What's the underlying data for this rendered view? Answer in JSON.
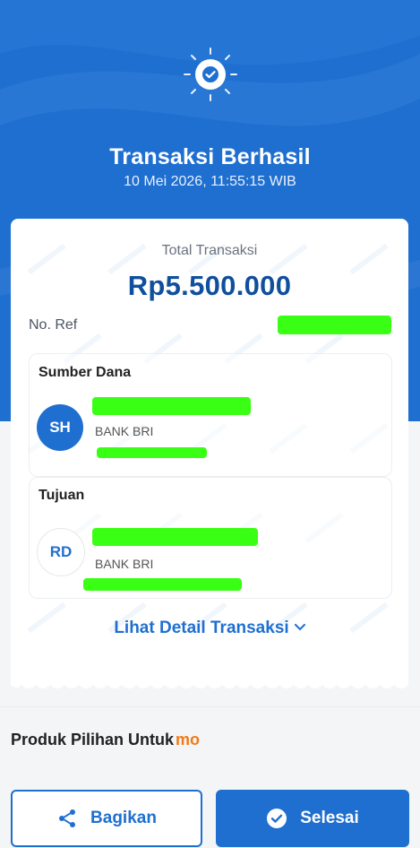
{
  "header": {
    "title": "Transaksi Berhasil",
    "datetime": "10 Mei 2026, 11:55:15 WIB",
    "icon": "check-icon"
  },
  "receipt": {
    "total_label": "Total Transaksi",
    "amount": "Rp5.500.000",
    "ref_label": "No. Ref",
    "source": {
      "title": "Sumber Dana",
      "initials": "SH",
      "bank": "BANK BRI"
    },
    "destination": {
      "title": "Tujuan",
      "initials": "RD",
      "bank": "BANK BRI"
    },
    "detail_link": "Lihat Detail Transaksi"
  },
  "promo": {
    "label": "Produk Pilihan Untuk",
    "brand": "mo"
  },
  "actions": {
    "share_label": "Bagikan",
    "done_label": "Selesai"
  },
  "colors": {
    "primary": "#1f6fd0",
    "amount": "#0f4f9e",
    "brand_orange": "#f07a1a",
    "redaction": "#39ff14"
  }
}
